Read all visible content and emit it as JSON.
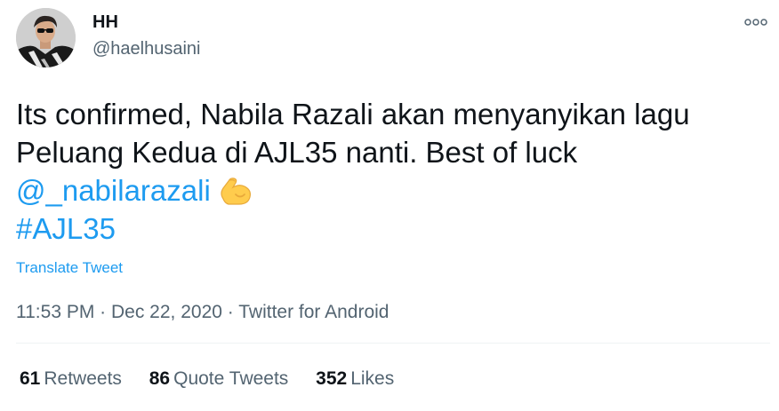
{
  "author": {
    "display_name": "HH",
    "handle": "@haelhusaini"
  },
  "tweet": {
    "line1": "Its confirmed, Nabila Razali akan menyanyikan lagu",
    "line2": "Peluang Kedua di AJL35 nanti. Best of luck",
    "mention": "@_nabilarazali",
    "hashtag": "#AJL35",
    "emoji_icon": "flexed-biceps-icon"
  },
  "translate_label": "Translate Tweet",
  "meta": {
    "time": "11:53 PM",
    "separator1": " · ",
    "date": "Dec 22, 2020",
    "separator2": " · ",
    "source": "Twitter for Android"
  },
  "stats": {
    "retweets_count": "61",
    "retweets_label": "Retweets",
    "quotes_count": "86",
    "quotes_label": "Quote Tweets",
    "likes_count": "352",
    "likes_label": "Likes"
  },
  "colors": {
    "link": "#1d9bf0",
    "text": "#0f1419",
    "secondary": "#536471",
    "divider": "#eff3f4"
  }
}
